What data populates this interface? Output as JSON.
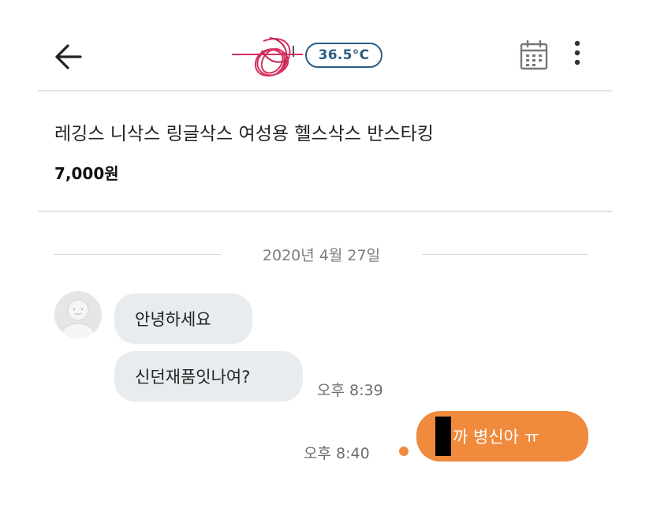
{
  "header": {
    "back_icon": "arrow-left-icon",
    "temperature": "36.5°C",
    "temperature_color": "#2a5d86",
    "calendar_icon": "calendar-icon",
    "more_icon": "more-vertical-icon"
  },
  "product": {
    "title": "레깅스 니삭스 링글삭스 여성용 헬스삭스 반스타킹",
    "price": "7,000원"
  },
  "chat": {
    "date": "2020년 4월 27일",
    "messages": [
      {
        "side": "left",
        "text": "안녕하세요"
      },
      {
        "side": "left",
        "text": "신던재품잇나여?",
        "time": "오후 8:39"
      },
      {
        "side": "right",
        "text": "까 병신아 ㅠ",
        "time": "오후 8:40"
      }
    ],
    "accent_color": "#f08a3c",
    "bubble_color": "#e9ecef"
  }
}
